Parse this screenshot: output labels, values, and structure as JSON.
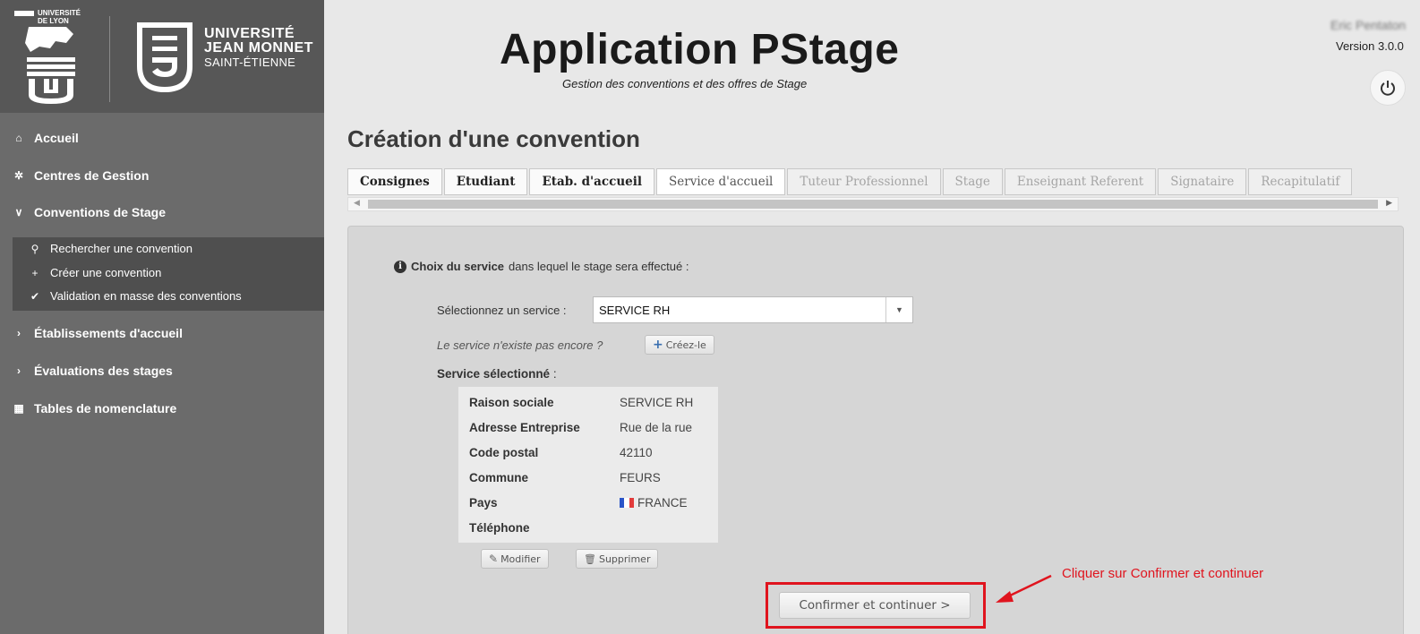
{
  "branding": {
    "ul_text_line1": "UNIVERSITÉ",
    "ul_text_line2": "DE LYON",
    "ujm_line1": "UNIVERSITÉ",
    "ujm_line2": "JEAN MONNET",
    "ujm_line3": "SAINT-ÉTIENNE"
  },
  "sidebar": {
    "items": [
      {
        "icon": "home-icon",
        "glyph": "⌂",
        "label": "Accueil"
      },
      {
        "icon": "gear-icon",
        "glyph": "✲",
        "label": "Centres de Gestion"
      },
      {
        "icon": "chevron-down-icon",
        "glyph": "∨",
        "label": "Conventions de Stage"
      },
      {
        "icon": "chevron-right-icon",
        "glyph": "›",
        "label": "Établissements d'accueil"
      },
      {
        "icon": "chevron-right-icon",
        "glyph": "›",
        "label": "Évaluations des stages"
      },
      {
        "icon": "table-icon",
        "glyph": "▦",
        "label": "Tables de nomenclature"
      }
    ],
    "subitems": [
      {
        "icon": "search-icon",
        "glyph": "⚲",
        "label": "Rechercher une convention"
      },
      {
        "icon": "plus-icon",
        "glyph": "+",
        "label": "Créer une convention"
      },
      {
        "icon": "check-icon",
        "glyph": "✔",
        "label": "Validation en masse des conventions"
      }
    ]
  },
  "header": {
    "title": "Application PStage",
    "subtitle": "Gestion des conventions et des offres de Stage",
    "user_name": "Eric Pentaton",
    "version": "Version 3.0.0"
  },
  "page": {
    "title": "Création d'une convention"
  },
  "tabs": [
    {
      "label": "Consignes",
      "state": "done"
    },
    {
      "label": "Etudiant",
      "state": "done"
    },
    {
      "label": "Etab. d'accueil",
      "state": "done"
    },
    {
      "label": "Service d'accueil",
      "state": "active"
    },
    {
      "label": "Tuteur Professionnel",
      "state": "disabled"
    },
    {
      "label": "Stage",
      "state": "disabled"
    },
    {
      "label": "Enseignant Referent",
      "state": "disabled"
    },
    {
      "label": "Signataire",
      "state": "disabled"
    },
    {
      "label": "Recapitulatif",
      "state": "disabled"
    }
  ],
  "form": {
    "choix_bold": "Choix du service",
    "choix_rest": "dans lequel le stage sera effectué :",
    "select_label": "Sélectionnez un service :",
    "select_value": "SERVICE RH",
    "not_exist_text": "Le service n'existe pas encore ?",
    "create_button": "Créez-le",
    "selected_label": "Service sélectionné",
    "selected_colon": " :",
    "details": [
      {
        "key": "Raison sociale",
        "value": "SERVICE RH"
      },
      {
        "key": "Adresse Entreprise",
        "value": "Rue de la rue"
      },
      {
        "key": "Code postal",
        "value": "42110"
      },
      {
        "key": "Commune",
        "value": "FEURS"
      },
      {
        "key": "Pays",
        "value": "FRANCE"
      },
      {
        "key": "Téléphone",
        "value": ""
      }
    ],
    "modify_button": "Modifier",
    "delete_button": "Supprimer",
    "confirm_button": "Confirmer et continuer >"
  },
  "annotation": {
    "text": "Cliquer sur Confirmer et continuer",
    "color": "#e0141e"
  }
}
